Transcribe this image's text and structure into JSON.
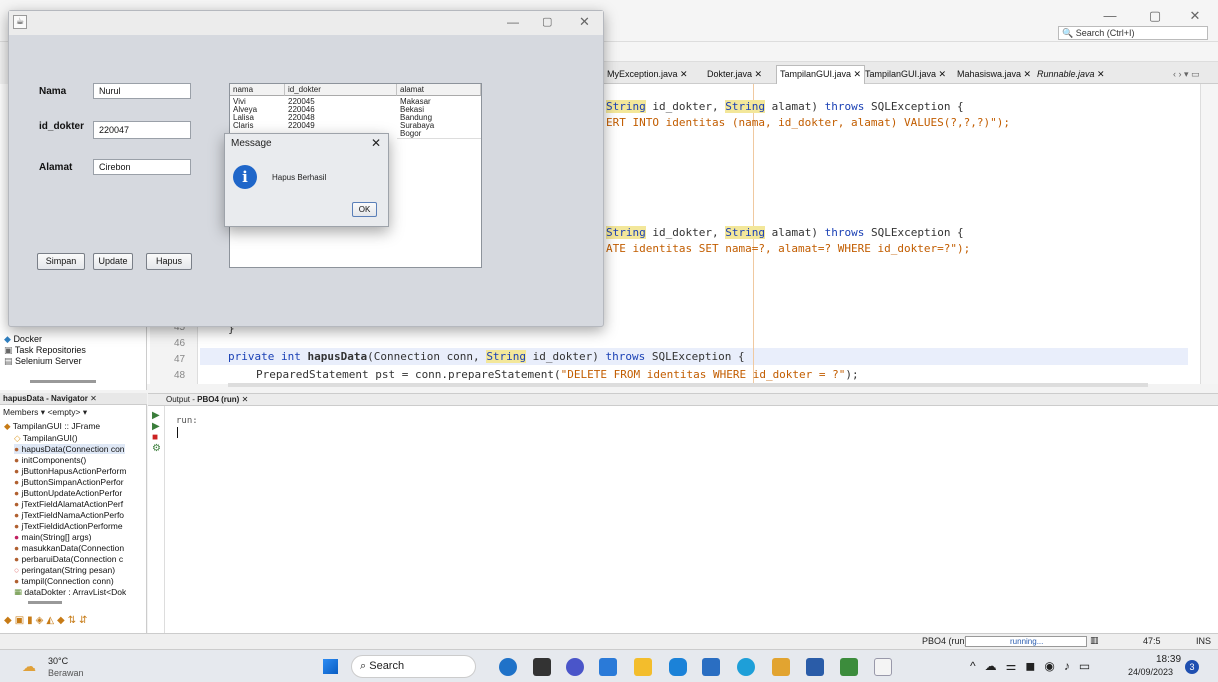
{
  "ide": {
    "search_placeholder": "Search (Ctrl+I)",
    "tabs": [
      {
        "label": "MyException.java"
      },
      {
        "label": "Dokter.java"
      },
      {
        "label": "TampilanGUI.java"
      },
      {
        "label": "TampilanGUI.java"
      },
      {
        "label": "Mahasiswa.java"
      },
      {
        "label": "Runnable.java"
      }
    ],
    "code_lines": {
      "l1a": "String",
      "l1b": " id_dokter, ",
      "l1c": "String",
      "l1d": " alamat) ",
      "l1e": "throws",
      "l1f": " SQLException {",
      "l2a": "ERT INTO identitas (nama, id_dokter, alamat) VALUES(?,?,?)\");",
      "l3a": "String",
      "l3b": " id_dokter, ",
      "l3c": "String",
      "l3d": " alamat) ",
      "l3e": "throws",
      "l3f": " SQLException {",
      "l4a": "ATE identitas SET nama=?, alamat=? WHERE id_dokter=?\");",
      "l5": "}",
      "l6a": "private int ",
      "l6b": "hapusData",
      "l6c": "(Connection conn, ",
      "l6d": "String",
      "l6e": " id_dokter) ",
      "l6f": "throws",
      "l6g": " SQLException {",
      "l7a": "PreparedStatement pst = conn.prepareStatement(",
      "l7b": "\"DELETE FROM identitas WHERE id_dokter = ?\"",
      "l7c": ");"
    },
    "line_numbers": [
      "45",
      "46",
      "47",
      "48"
    ],
    "left_items": [
      "Docker",
      "Task Repositories",
      "Selenium Server"
    ],
    "navigator": {
      "title": "hapusData - Navigator",
      "filter": "Members",
      "filter2": "<empty>",
      "root": "TampilanGUI :: JFrame",
      "items": [
        "TampilanGUI()",
        "hapusData(Connection con",
        "initComponents()",
        "jButtonHapusActionPerform",
        "jButtonSimpanActionPerfor",
        "jButtonUpdateActionPerfor",
        "jTextFieldAlamatActionPerf",
        "jTextFieldNamaActionPerfo",
        "jTextFieldidActionPerforme",
        "main(String[] args)",
        "masukkanData(Connection",
        "perbaruiData(Connection c",
        "peringatan(String pesan)",
        "tampil(Connection conn)",
        "dataDokter : ArrayList<Dok"
      ]
    },
    "output": {
      "tab_prefix": "Output - ",
      "tab_label": "PBO4 (run)",
      "text": "run:"
    },
    "status": {
      "project": "PBO4 (run)",
      "running": "running...",
      "position": "47:5",
      "mode": "INS"
    }
  },
  "app": {
    "labels": {
      "nama": "Nama",
      "id_dokter": "id_dokter",
      "alamat": "Alamat"
    },
    "fields": {
      "nama": "Nurul",
      "id_dokter": "220047",
      "alamat": "Cirebon"
    },
    "buttons": {
      "simpan": "Simpan",
      "update": "Update",
      "hapus": "Hapus"
    },
    "table": {
      "columns": [
        "nama",
        "id_dokter",
        "alamat"
      ],
      "rows": [
        [
          "Vivi",
          "220045",
          "Makasar"
        ],
        [
          "Alveya",
          "220046",
          "Bekasi"
        ],
        [
          "Lalisa",
          "220048",
          "Bandung"
        ],
        [
          "Claris",
          "220049",
          "Surabaya"
        ],
        [
          "",
          "",
          "Bogor"
        ]
      ]
    }
  },
  "dialog": {
    "title": "Message",
    "message": "Hapus Berhasil",
    "ok": "OK"
  },
  "taskbar": {
    "weather_temp": "30°C",
    "weather_desc": "Berawan",
    "search": "Search",
    "time": "18:39",
    "date": "24/09/2023",
    "notifications": "3"
  }
}
